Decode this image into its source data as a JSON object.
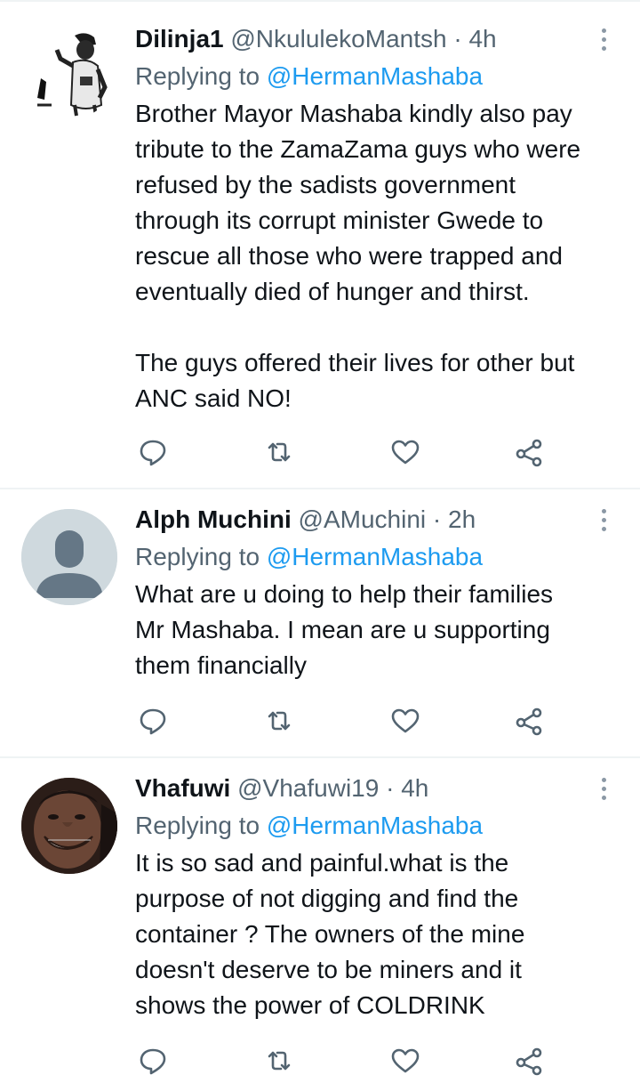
{
  "tweets": [
    {
      "name": "Dilinja1",
      "handle": "@NkululekoMantsh",
      "separator": "·",
      "time": "4h",
      "replying_prefix": "Replying to ",
      "replying_to": "@HermanMashaba",
      "text": "Brother Mayor Mashaba kindly also pay\ntribute to the ZamaZama guys who were\nrefused by the sadists government\nthrough its corrupt minister Gwede to\nrescue all those who were trapped and\neventually died of hunger and thirst.\n\nThe guys offered their lives for other but\nANC said NO!",
      "avatar": "photo-avatar-bw"
    },
    {
      "name": "Alph Muchini",
      "handle": "@AMuchini",
      "separator": "·",
      "time": "2h",
      "replying_prefix": "Replying to ",
      "replying_to": "@HermanMashaba",
      "text": "What are u doing to help their families\nMr Mashaba. I mean are u supporting\nthem financially",
      "avatar": "default-profile-avatar"
    },
    {
      "name": "Vhafuwi",
      "handle": "@Vhafuwi19",
      "separator": "·",
      "time": "4h",
      "replying_prefix": "Replying to ",
      "replying_to": "@HermanMashaba",
      "text": "It is so sad and painful.what is the\npurpose of not digging and find the\ncontainer ? The owners of the mine\ndoesn't deserve to be miners and it\nshows the power of COLDRINK",
      "avatar": "photo-avatar-smiling"
    }
  ],
  "icons": [
    "reply-icon",
    "retweet-icon",
    "like-icon",
    "share-icon",
    "more-options-icon"
  ],
  "colors": {
    "text": "#0f1419",
    "secondary": "#536471",
    "link": "#1d9bf0",
    "divider": "#eff3f4",
    "icon": "#536471"
  }
}
